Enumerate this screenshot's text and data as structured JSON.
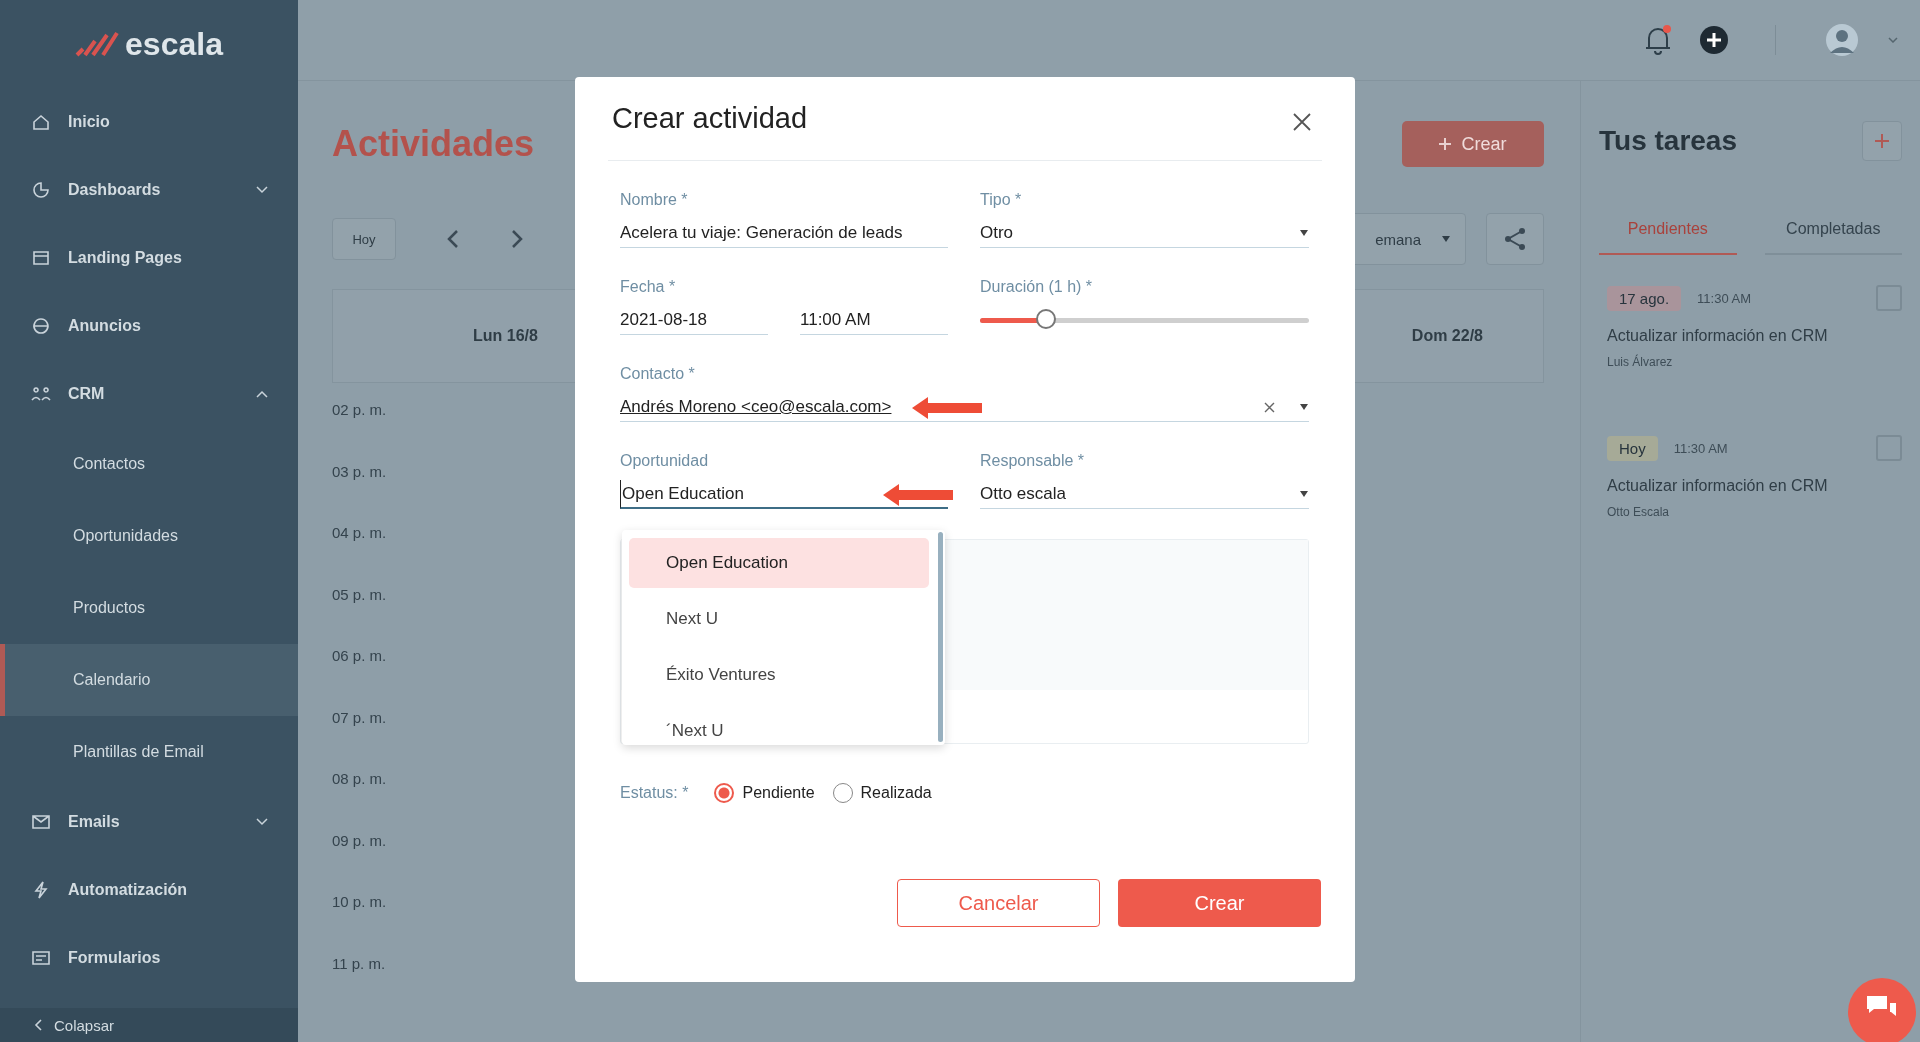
{
  "sidebar": {
    "logo": "escala",
    "items": [
      {
        "label": "Inicio",
        "kind": "link",
        "selected": false
      },
      {
        "label": "Dashboards",
        "kind": "group",
        "expanded": false,
        "selected": false
      },
      {
        "label": "Landing Pages",
        "kind": "link",
        "selected": false
      },
      {
        "label": "Anuncios",
        "kind": "link",
        "selected": false
      },
      {
        "label": "CRM",
        "kind": "group",
        "expanded": true,
        "selected": false,
        "children": [
          {
            "label": "Contactos",
            "selected": false
          },
          {
            "label": "Oportunidades",
            "selected": false
          },
          {
            "label": "Productos",
            "selected": false
          },
          {
            "label": "Calendario",
            "selected": true
          },
          {
            "label": "Plantillas de Email",
            "selected": false
          }
        ]
      },
      {
        "label": "Emails",
        "kind": "group",
        "expanded": false,
        "selected": false
      },
      {
        "label": "Automatización",
        "kind": "link",
        "selected": false
      },
      {
        "label": "Formularios",
        "kind": "link",
        "selected": false
      }
    ],
    "collapse": "Colapsar"
  },
  "page_title": "Actividades",
  "create_button": "Crear",
  "toolbar": {
    "today": "Hoy",
    "view": "emana"
  },
  "calendar": {
    "days": [
      "Lun 16/8",
      "Dom 22/8"
    ],
    "hours": [
      "02 p. m.",
      "03 p. m.",
      "04 p. m.",
      "05 p. m.",
      "06 p. m.",
      "07 p. m.",
      "08 p. m.",
      "09 p. m.",
      "10 p. m.",
      "11 p. m."
    ]
  },
  "tasks_panel": {
    "title": "Tus tareas",
    "tabs": [
      {
        "label": "Pendientes",
        "selected": true
      },
      {
        "label": "Completadas",
        "selected": false
      }
    ],
    "tasks": [
      {
        "date": "17 ago.",
        "color": "#a9949b",
        "time": "11:30 AM",
        "title": "Actualizar información en CRM",
        "person": "Luis Álvarez",
        "checked": false
      },
      {
        "date": "Hoy",
        "color": "#a6aa97",
        "time": "11:30 AM",
        "title": "Actualizar información en CRM",
        "person": "Otto Escala",
        "checked": false
      }
    ]
  },
  "modal": {
    "title": "Crear actividad",
    "nombre": {
      "label": "Nombre *",
      "value": "Acelera tu viaje: Generación de leads"
    },
    "tipo": {
      "label": "Tipo *",
      "value": "Otro"
    },
    "fecha": {
      "label": "Fecha *",
      "date": "2021-08-18",
      "time": "11:00 AM"
    },
    "duracion": {
      "label": "Duración (1 h) *",
      "level": 0.2
    },
    "contacto": {
      "label": "Contacto *",
      "value": "Andrés Moreno <ceo@escala.com>"
    },
    "oportunidad": {
      "label": "Oportunidad",
      "value": "Open Education",
      "options": [
        {
          "label": "Open Education",
          "selected": true
        },
        {
          "label": "Next U",
          "selected": false
        },
        {
          "label": "Éxito Ventures",
          "selected": false
        },
        {
          "label": "´Next U",
          "selected": false
        }
      ]
    },
    "responsable": {
      "label": "Responsable *",
      "value": "Otto escala"
    },
    "estatus": {
      "label": "Estatus: *",
      "options": [
        {
          "label": "Pendiente",
          "selected": true
        },
        {
          "label": "Realizada",
          "selected": false
        }
      ]
    },
    "cancel_button": "Cancelar",
    "submit_button": "Crear"
  }
}
